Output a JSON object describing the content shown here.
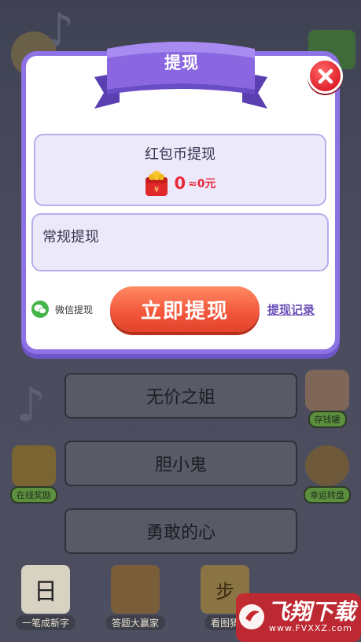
{
  "modal": {
    "title": "提现",
    "red_packet": {
      "title": "红包币提现",
      "amount": "0",
      "rmb": "≈0元"
    },
    "regular": {
      "title": "常规提现"
    },
    "wechat_label": "微信提现",
    "withdraw_button": "立即提现",
    "records_link": "提现记录"
  },
  "game": {
    "answers": [
      "无价之姐",
      "胆小鬼",
      "勇敢的心"
    ],
    "side_left": "在线奖励",
    "side_right_top": "存钱罐",
    "side_right_bottom": "幸运转盘",
    "bottom_items": [
      "一笔成新字",
      "答题大赢家",
      "看图猜"
    ],
    "bottom_glyphs": [
      "日",
      "步"
    ]
  },
  "watermark": {
    "text": "飞翔下载",
    "url": "www.FVXXZ.com"
  },
  "colors": {
    "modal_border": "#8d72e6",
    "ribbon": "#8a66e0",
    "withdraw_button": "#f2553a",
    "amount": "#e9293a",
    "close_button": "#e0202a"
  }
}
